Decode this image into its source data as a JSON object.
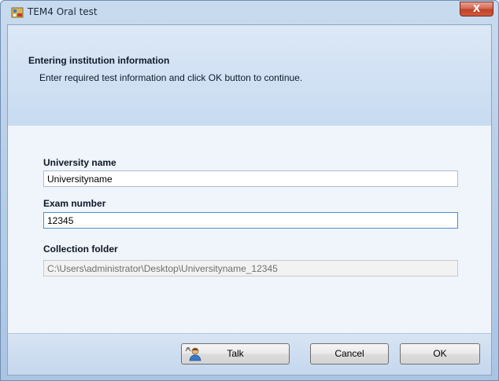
{
  "window": {
    "title": "TEM4 Oral test",
    "close_glyph": "X",
    "app_icon": "app-icon"
  },
  "header": {
    "title": "Entering institution information",
    "subtitle": "Enter required test information and click OK button to continue."
  },
  "form": {
    "university": {
      "label": "University name",
      "value": "Universityname"
    },
    "exam": {
      "label": "Exam number",
      "value": "12345"
    },
    "folder": {
      "label": "Collection folder",
      "value": "C:\\Users\\administrator\\Desktop\\Universityname_12345"
    }
  },
  "buttons": {
    "talk": "Talk",
    "talk_icon": "person-speaking-icon",
    "cancel": "Cancel",
    "ok": "OK"
  }
}
